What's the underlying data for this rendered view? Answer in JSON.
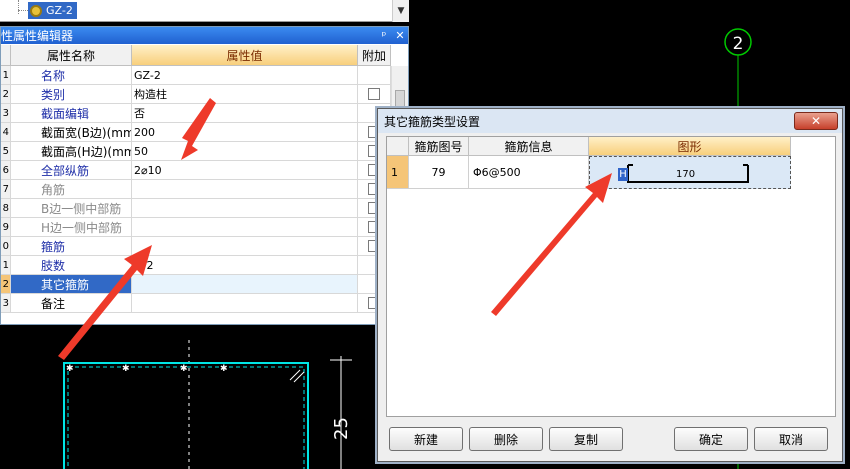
{
  "tree": {
    "selected_node": "GZ-2",
    "scroll_arrow": "▼",
    "node_icon": "gear-icon"
  },
  "property_editor": {
    "title": "性属性编辑器",
    "pin_icon": "pin-icon",
    "close_icon": "close-icon",
    "columns": {
      "index": "",
      "name": "属性名称",
      "value": "属性值",
      "extra": "附加"
    },
    "rows": [
      {
        "idx": "1",
        "name": "名称",
        "value": "GZ-2",
        "style": "blue",
        "checkbox": false
      },
      {
        "idx": "2",
        "name": "类别",
        "value": "构造柱",
        "style": "blue",
        "checkbox": true
      },
      {
        "idx": "3",
        "name": "截面编辑",
        "value": "否",
        "style": "blue",
        "checkbox": false
      },
      {
        "idx": "4",
        "name": "截面宽(B边)(mm)",
        "value": "200",
        "style": "blk",
        "checkbox": true
      },
      {
        "idx": "5",
        "name": "截面高(H边)(mm)",
        "value": "50",
        "style": "blk",
        "checkbox": true
      },
      {
        "idx": "6",
        "name": "全部纵筋",
        "value": "2⌀10",
        "style": "blue",
        "checkbox": true
      },
      {
        "idx": "7",
        "name": "角筋",
        "value": "",
        "style": "gray",
        "checkbox": true
      },
      {
        "idx": "8",
        "name": "B边一侧中部筋",
        "value": "",
        "style": "gray",
        "checkbox": true
      },
      {
        "idx": "9",
        "name": "H边一侧中部筋",
        "value": "",
        "style": "gray",
        "checkbox": true
      },
      {
        "idx": "0",
        "name": "箍筋",
        "value": "",
        "style": "blue",
        "checkbox": true
      },
      {
        "idx": "1",
        "name": "肢数",
        "value": "1*2",
        "style": "blue",
        "checkbox": false
      },
      {
        "idx": "2",
        "name": "其它箍筋",
        "value": "",
        "style": "sel",
        "checkbox": false
      },
      {
        "idx": "3",
        "name": "备注",
        "value": "",
        "style": "blk",
        "checkbox": true
      }
    ]
  },
  "dialog": {
    "title": "其它箍筋类型设置",
    "close_label": "✕",
    "columns": {
      "index": "",
      "number": "箍筋图号",
      "info": "箍筋信息",
      "shape": "图形"
    },
    "rows": [
      {
        "idx": "1",
        "number": "79",
        "info": "Φ6@500",
        "shape_value": "170",
        "cursor_char": "H"
      }
    ],
    "buttons": {
      "new": "新建",
      "delete": "删除",
      "copy": "复制",
      "ok": "确定",
      "cancel": "取消"
    }
  },
  "cad": {
    "axis_label": "2",
    "dimension": "25",
    "colors": {
      "cyan": "#00e5e5",
      "green": "#00c800",
      "red_arrow": "#ee3a2a"
    }
  }
}
